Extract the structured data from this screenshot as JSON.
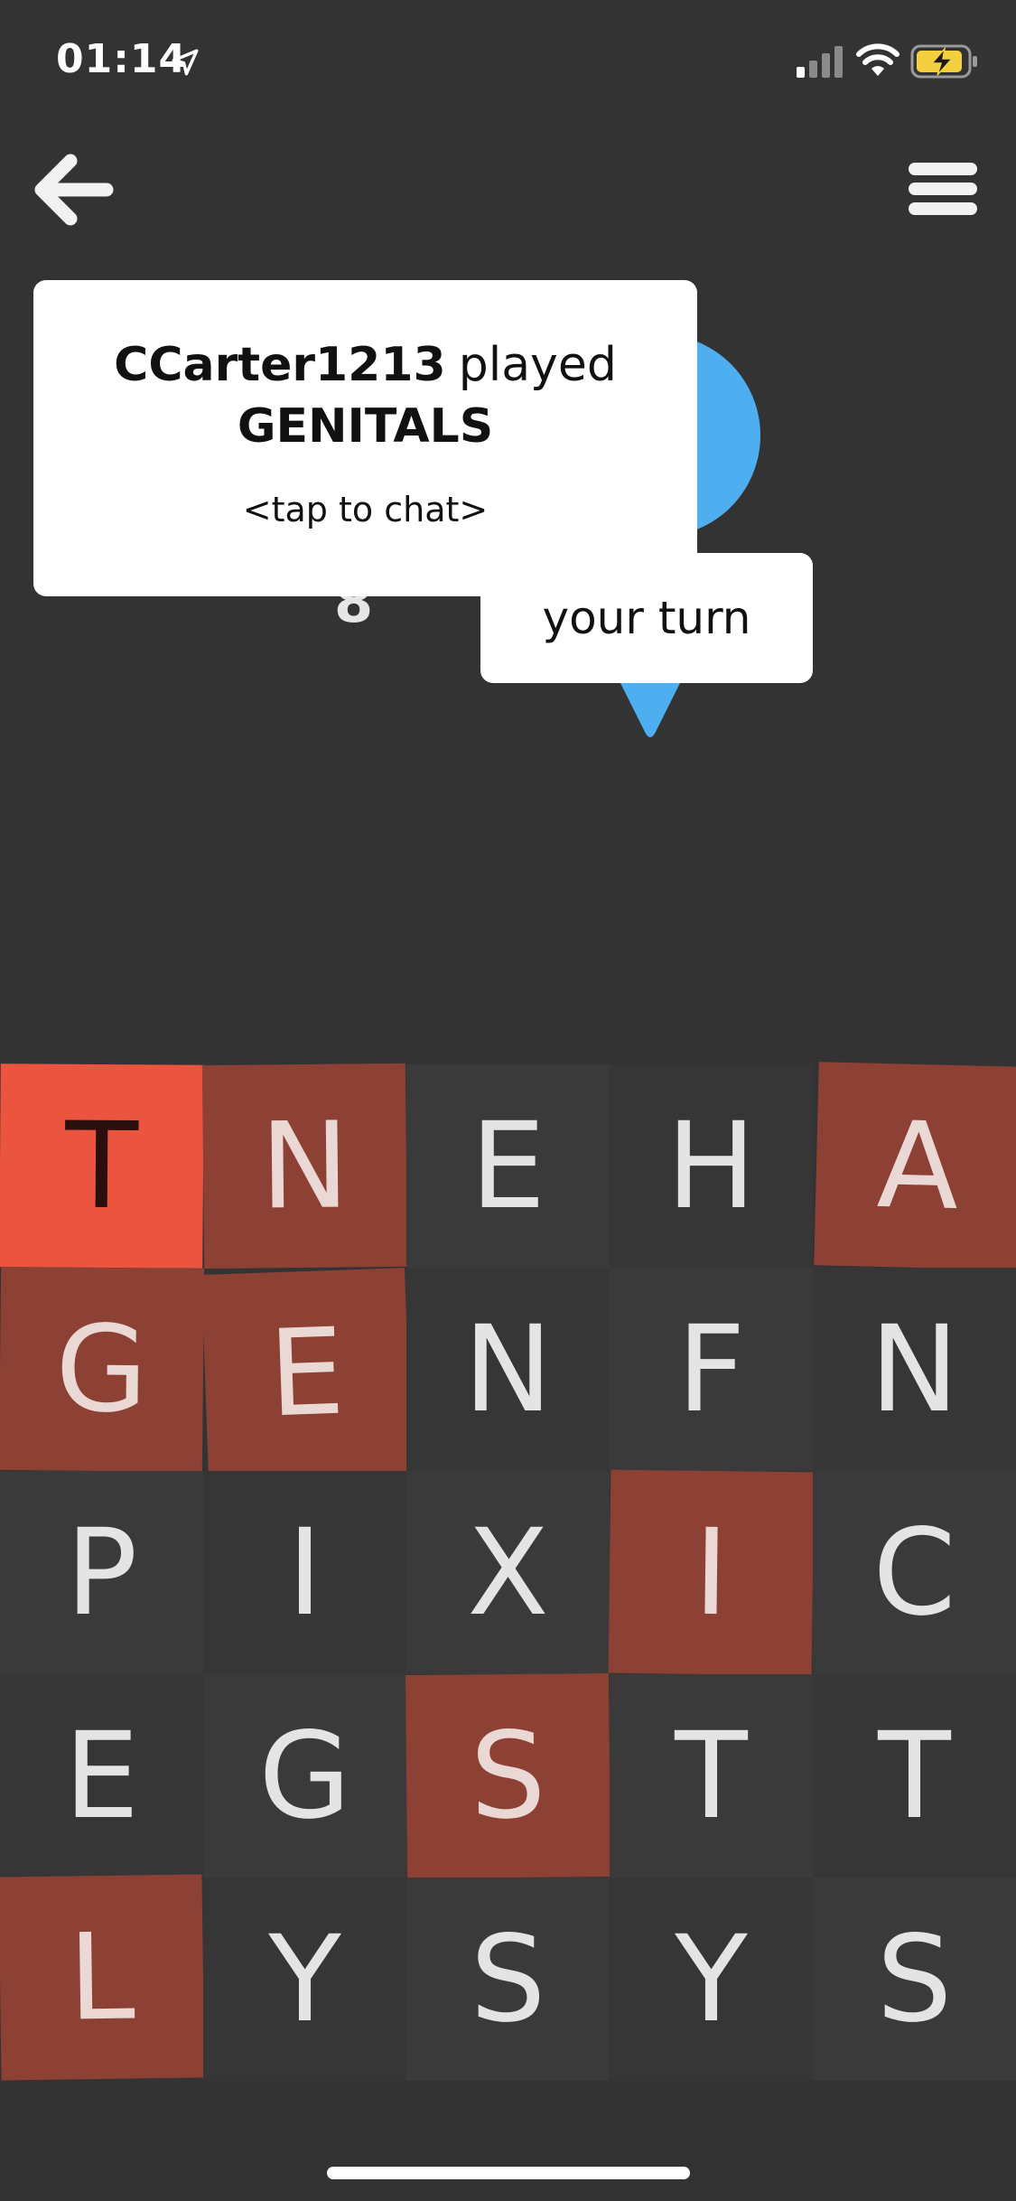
{
  "status_bar": {
    "time": "01:14"
  },
  "game": {
    "score": "8",
    "last_play": {
      "player": "CCarter1213",
      "verb": "played",
      "word": "GENITALS",
      "hint": "<tap to chat>"
    },
    "turn_label": "your turn"
  },
  "colors": {
    "background": "#333334",
    "tile_selected": "#8d4034",
    "tile_current": "#eb5540",
    "avatar_blue": "#4daff0"
  },
  "board": {
    "rows": [
      [
        {
          "letter": "T",
          "state": "current"
        },
        {
          "letter": "N",
          "state": "selected"
        },
        {
          "letter": "E",
          "state": "none"
        },
        {
          "letter": "H",
          "state": "none"
        },
        {
          "letter": "A",
          "state": "selected"
        }
      ],
      [
        {
          "letter": "G",
          "state": "selected"
        },
        {
          "letter": "E",
          "state": "selected"
        },
        {
          "letter": "N",
          "state": "none"
        },
        {
          "letter": "F",
          "state": "none"
        },
        {
          "letter": "N",
          "state": "none"
        }
      ],
      [
        {
          "letter": "P",
          "state": "none"
        },
        {
          "letter": "I",
          "state": "none"
        },
        {
          "letter": "X",
          "state": "none"
        },
        {
          "letter": "I",
          "state": "selected"
        },
        {
          "letter": "C",
          "state": "none"
        }
      ],
      [
        {
          "letter": "E",
          "state": "none"
        },
        {
          "letter": "G",
          "state": "none"
        },
        {
          "letter": "S",
          "state": "selected"
        },
        {
          "letter": "T",
          "state": "none"
        },
        {
          "letter": "T",
          "state": "none"
        }
      ],
      [
        {
          "letter": "L",
          "state": "selected"
        },
        {
          "letter": "Y",
          "state": "none"
        },
        {
          "letter": "S",
          "state": "none"
        },
        {
          "letter": "Y",
          "state": "none"
        },
        {
          "letter": "S",
          "state": "none"
        }
      ]
    ]
  }
}
